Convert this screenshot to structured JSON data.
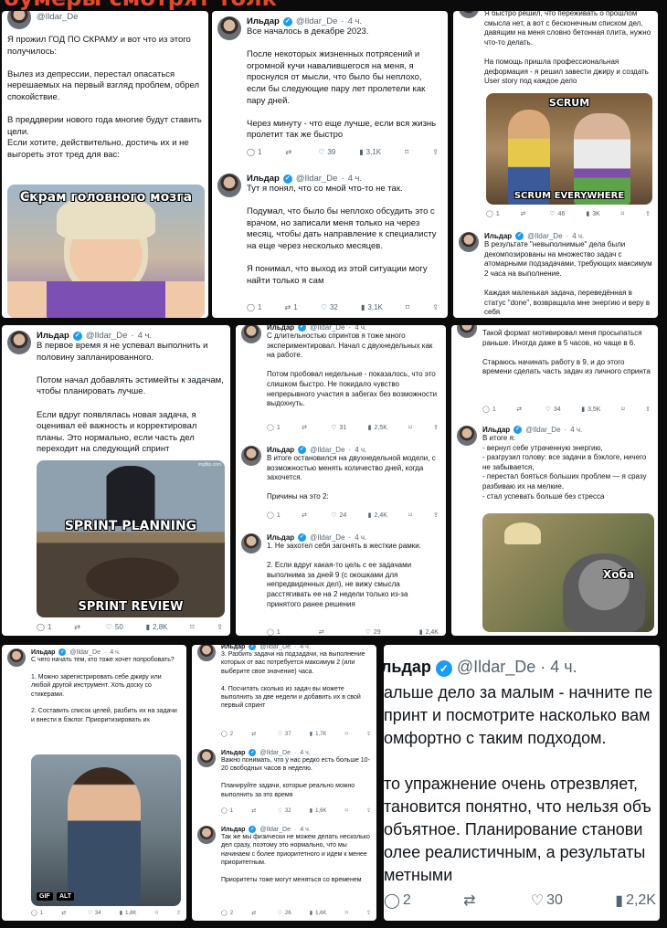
{
  "header": {
    "title": "бумеры смотрят толк"
  },
  "author": {
    "name": "Ильдар",
    "handle": "@Ildar_De",
    "time": "4 ч.",
    "verified": "✓"
  },
  "icons": {
    "reply": "reply-icon",
    "retweet": "retweet-icon",
    "like": "like-icon",
    "views": "views-icon",
    "bookmark": "bookmark-icon",
    "share": "share-icon"
  },
  "colors": {
    "accent": "#1d9bf0",
    "header": "#e0492e",
    "bg": "#0b0b0b"
  },
  "card1": {
    "handle": "@Ildar_De",
    "text": "Я прожил ГОД ПО СКРАМУ и вот что из этого получилось:\n\nВылез из депрессии, перестал опасаться нерешаемых на первый взгляд проблем, обрел спокойствие.\n\nВ преддверии нового года многие будут ставить цели.\nЕсли хотите, действительно, достичь их и не выгореть этот тред для вас:",
    "meme_caption": "Скрам головного мозга"
  },
  "card2": {
    "t1": {
      "text": "Все началось в декабре 2023.\n\nПосле некоторых жизненных потрясений и огромной кучи навалившегося на меня, я проснулся от мысли, что было бы неплохо, если бы следующие пару лет пролетели как пару дней.\n\nЧерез минуту - что еще лучше, если вся жизнь пролетит так же быстро",
      "reply": "1",
      "retweet": "",
      "like": "39",
      "views": "3,1K"
    },
    "t2": {
      "text": "Тут я понял, что со мной что-то не так.\n\nПодумал, что было бы неплохо обсудить это с врачом, но записали меня только на через месяц, чтобы дать направление к специалисту на еще через несколько месяцев.\n\nЯ понимал, что выход из этой ситуации могу найти только я сам",
      "reply": "1",
      "retweet": "1",
      "like": "32",
      "views": "3,1K"
    }
  },
  "card3": {
    "t1": {
      "text": "Я быстро решил, что переживать о прошлом смысла нет, а вот с бесконечным списком дел, давящим на меня словно бетонная плита, нужно что-то делать.\n\nНа помощь пришла профессиональная деформация - я решил завести джиру и создать User story под каждое дело",
      "top": "SCRUM",
      "bottom": "SCRUM EVERYWHERE",
      "reply": "1",
      "retweet": "",
      "like": "46",
      "views": "3K"
    },
    "t2": {
      "text": "В результате \"невыполнимые\" дела были декомпозированы на множество задач с атомарными подзадачами, требующих максимум 2 часа на выполнение.\n\nКаждая маленькая задача, переведённая в статус \"done\", возвращала мне энергию и веру в себя"
    }
  },
  "card4": {
    "text": "В первое время я не успевал выполнить и половину запланированного.\n\nПотом начал добавлять эстимейты к задачам, чтобы планировать лучше.\n\nЕсли вдруг появлялась новая задача, я оценивал её важность и корректировал планы. Это нормально, если часть дел переходит на следующий спринт",
    "top": "SPRINT PLANNING",
    "bottom": "SPRINT REVIEW",
    "watermark": "imgflip.com",
    "reply": "1",
    "retweet": "",
    "like": "50",
    "views": "2,8K"
  },
  "card5": {
    "t1": {
      "text": "С длительностью спринтов я тоже много экспериментировал. Начал с двухнедельных как на работе.\n\nПотом пробовал недельные - показалось, что это слишком быстро. Не покидало чувство непрерывного участия в забегах без возможности выдохнуть.",
      "reply": "1",
      "retweet": "",
      "like": "31",
      "views": "2,5K"
    },
    "t2": {
      "text": "В итоге остановился на двухнедельной модели, с возможностью менять количество дней, когда захочется.\n\nПричины на это 2:",
      "reply": "1",
      "retweet": "",
      "like": "24",
      "views": "2,4K"
    },
    "t3": {
      "text": "1. Не захотел себя загонять в жесткие рамки.\n\n2. Если вдруг какая-то цель с ее задачами выполнима за дней 9 (с окошками для непредвиденных дел), не вижу смысла расстягивать ее на 2 недели только из-за принятого ранее решения",
      "reply": "1",
      "retweet": "",
      "like": "29",
      "views": "2,4K"
    }
  },
  "card6": {
    "t1": {
      "text": "Такой формат мотивировал меня просыпаться раньше. Иногда даже в 5 часов, но чаще в 6.\n\nСтараюсь начинать работу в 9, и до этого времени сделать часть задач из личного спринта",
      "reply": "1",
      "retweet": "",
      "like": "34",
      "views": "3,5K"
    },
    "t2": {
      "text": "В итоге я:\n- вернул себе утраченную энергию,\n- разгрузил голову: все задачи в бэклоге, ничего не забывается,\n- перестал бояться больших проблем — я сразу разбиваю их на мелкие,\n- стал успевать больше без стресса",
      "caption": "Хоба"
    }
  },
  "card7": {
    "text": "С чего начать тем, кто тоже хочет попробовать?\n\n1. Можно зарегистрировать себе джиру или любой другой инструмент. Хоть доску со стикерами.\n\n2. Составить список целей, разбить их на задачи и внести в бэклог. Приоритизировать их",
    "gif": "GIF",
    "alt": "ALT",
    "reply": "1",
    "retweet": "",
    "like": "34",
    "views": "1,8K"
  },
  "card8": {
    "t1": {
      "text": "3. Разбить задачи на подзадачи, на выполнение которых от вас потребуется максимум 2 (или выберите свое значение) часа.\n\n4. Посчитать сколько из задач вы можете выполнить за две недели и добавить их в свой первый спринт",
      "reply": "2",
      "retweet": "",
      "like": "37",
      "views": "1,7K"
    },
    "t2": {
      "text": "Важно понимать, что у нас редко есть больше 10-20 свободных часов в неделю.\n\nПланируйте задачи, которые реально можно выполнить за это время",
      "reply": "1",
      "retweet": "",
      "like": "32",
      "views": "1,6K"
    },
    "t3": {
      "text": "Так же мы физически не можем делать несколько дел сразу, поэтому это нормально, что мы начинаем с более приоритетного и идем к менее приоритетным.\n\nПриоритеты тоже могут меняться со временем",
      "reply": "2",
      "retweet": "",
      "like": "26",
      "views": "1,6K"
    }
  },
  "card9": {
    "name": "Ильдар",
    "handle": "@Ildar_De",
    "time": "4 ч.",
    "text": "альше дело за малым - начните пе\nпринт и посмотрите насколько вам\nомфортно с таким подходом.\n\nто упражнение очень отрезвляет, \nтановится понятно, что нельзя объ\nобъятное. Планирование станови\nолее реалистичным, а результаты\nметными",
    "reply": "2",
    "retweet": "",
    "like": "30",
    "views": "2,2K"
  }
}
